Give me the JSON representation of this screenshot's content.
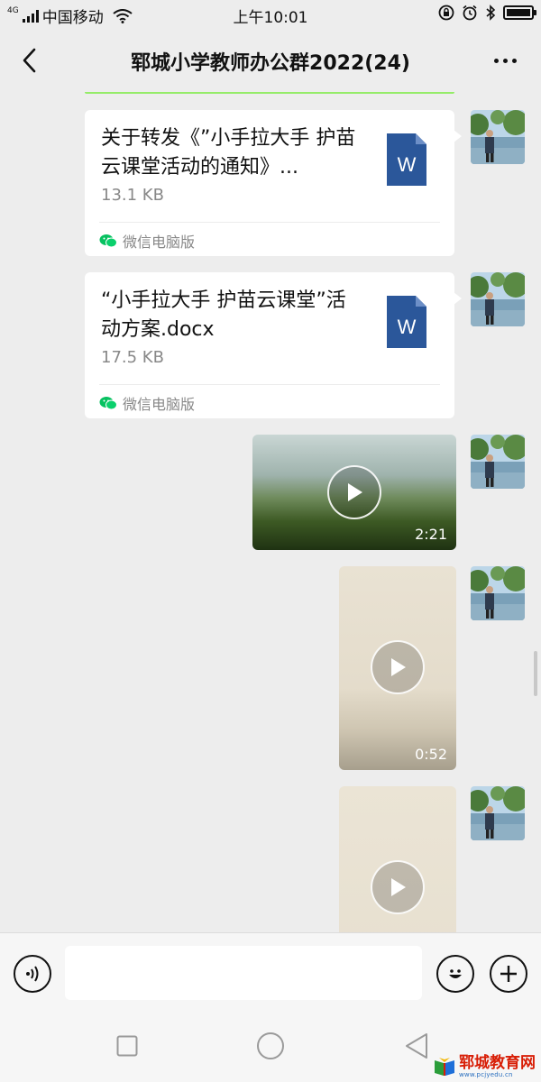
{
  "status_bar": {
    "network": "4G",
    "carrier": "中国移动",
    "time": "上午10:01"
  },
  "header": {
    "title": "郓城小学教师办公群2022(24)"
  },
  "messages": [
    {
      "type": "file",
      "file_name": "关于转发《”小手拉大手 护苗云课堂活动的通知》...",
      "file_size": "13.1 KB",
      "file_icon_letter": "W",
      "source": "微信电脑版"
    },
    {
      "type": "file",
      "file_name": "“小手拉大手 护苗云课堂”活动方案.docx",
      "file_size": "17.5 KB",
      "file_icon_letter": "W",
      "source": "微信电脑版"
    },
    {
      "type": "video",
      "duration": "2:21"
    },
    {
      "type": "video",
      "duration": "0:52"
    },
    {
      "type": "video",
      "duration": ""
    }
  ],
  "input": {
    "value": "",
    "placeholder": ""
  },
  "watermark": {
    "title": "郓城教育网",
    "url": "www.pcjyedu.cn"
  },
  "colors": {
    "background": "#ededed",
    "bubble_sent": "#95ec69",
    "word_blue": "#2b579a",
    "wechat_green": "#07c160"
  }
}
